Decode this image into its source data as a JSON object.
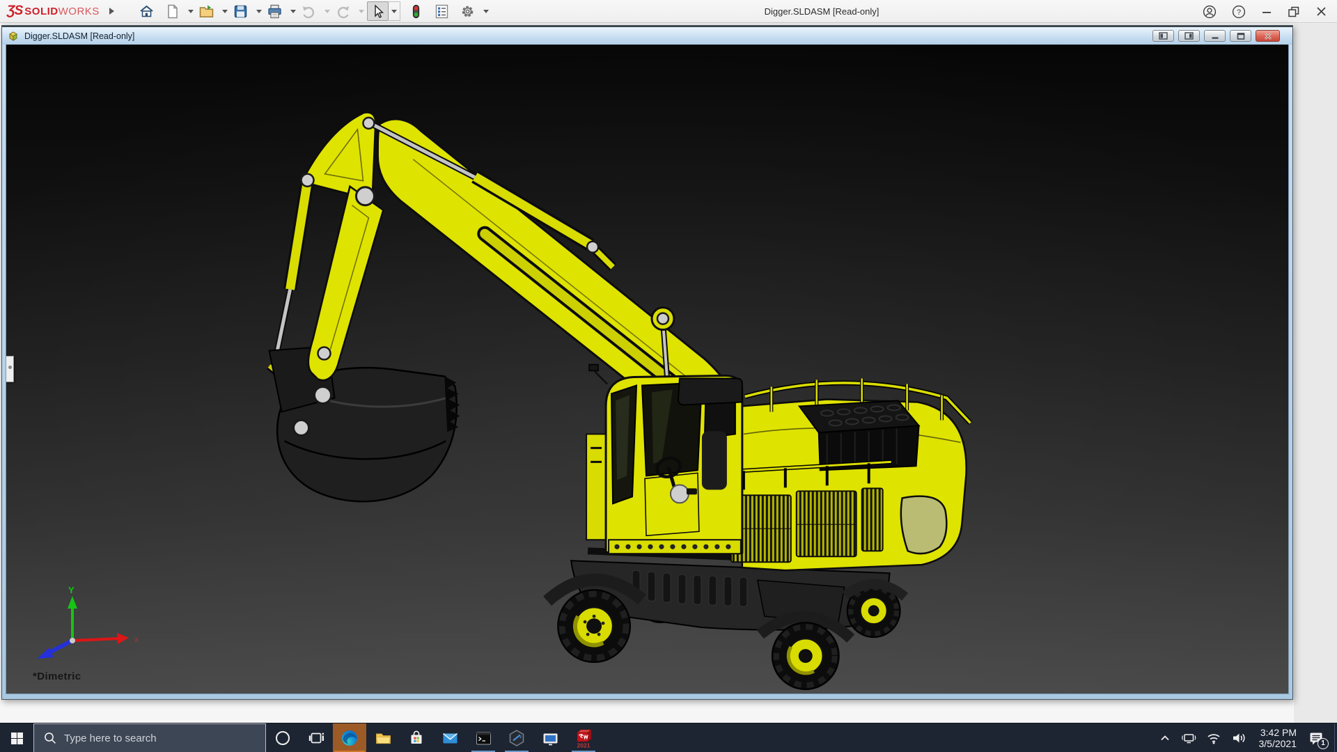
{
  "window": {
    "title": "Digger.SLDASM [Read-only]"
  },
  "brand": {
    "symbol": "ƷS",
    "name_bold": "SOLID",
    "name_light": "WORKS"
  },
  "toolbar": {
    "buttons": [
      "home",
      "new-document",
      "open",
      "save",
      "print",
      "undo",
      "redo",
      "select",
      "rebuild-traffic-light",
      "file-properties",
      "options-gear"
    ],
    "help_glyph": "?"
  },
  "document": {
    "title": "Digger.SLDASM [Read-only]",
    "view_orientation_label": "*Dimetric",
    "triad": {
      "x_label": "x",
      "y_label": "Y"
    }
  },
  "taskbar": {
    "search_placeholder": "Type here to search",
    "pinned_apps": [
      "start",
      "cortana",
      "task-view",
      "edge",
      "file-explorer",
      "microsoft-store",
      "mail",
      "command-prompt",
      "hexagon-app",
      "remote-desktop",
      "solidworks-2021"
    ],
    "running_apps": [
      "edge",
      "command-prompt",
      "hexagon-app",
      "solidworks-2021"
    ],
    "solidworks_year_badge": "2021",
    "tray": {
      "time": "3:42 PM",
      "date": "3/5/2021",
      "notification_count": "1"
    }
  },
  "colors": {
    "brand_red": "#cf2029",
    "excavator_yellow": "#dfe300",
    "taskbar_bg": "#1d2432",
    "edge_active_bg": "#9c5a26",
    "edge_active_underline": "#d07828",
    "running_underline": "#6b98c8",
    "doc_titlebar_top": "#eaf4fd",
    "doc_titlebar_bottom": "#b2cfe8",
    "viewport_top": "#060606",
    "viewport_bottom": "#4a4a4a"
  }
}
